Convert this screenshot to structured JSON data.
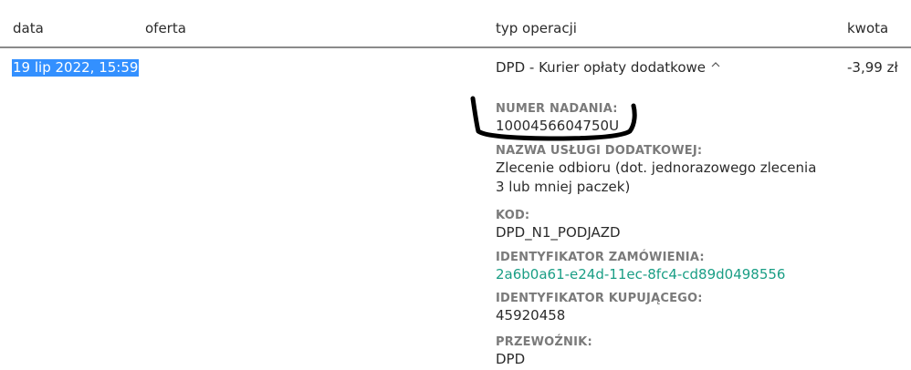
{
  "table": {
    "headers": {
      "date": "data",
      "offer": "oferta",
      "operation_type": "typ operacji",
      "amount": "kwota"
    },
    "row": {
      "date": "19 lip 2022, 15:59",
      "offer": "",
      "operation_type": "DPD - Kurier opłaty dodatkowe",
      "amount": "-3,99 zł",
      "expand_icon": "chevron-up-icon",
      "details": [
        {
          "label": "NUMER NADANIA:",
          "value": "1000456604750U"
        },
        {
          "label": "NAZWA USŁUGI DODATKOWEJ:",
          "value": "Zlecenie odbioru (dot. jednorazowego zlecenia 3 lub mniej paczek)"
        },
        {
          "label": "KOD:",
          "value": "DPD_N1_PODJAZD"
        },
        {
          "label": "IDENTYFIKATOR ZAMÓWIENIA:",
          "value": "2a6b0a61-e24d-11ec-8fc4-cd89d0498556",
          "link": true
        },
        {
          "label": "IDENTYFIKATOR KUPUJĄCEGO:",
          "value": "45920458"
        },
        {
          "label": "PRZEWOŹNIK:",
          "value": "DPD"
        }
      ]
    }
  },
  "colors": {
    "selection": "#3390ff",
    "link": "#1a9e85",
    "label": "#7a7a7a",
    "divider": "#8a8a8a",
    "annotation": "#000000"
  }
}
